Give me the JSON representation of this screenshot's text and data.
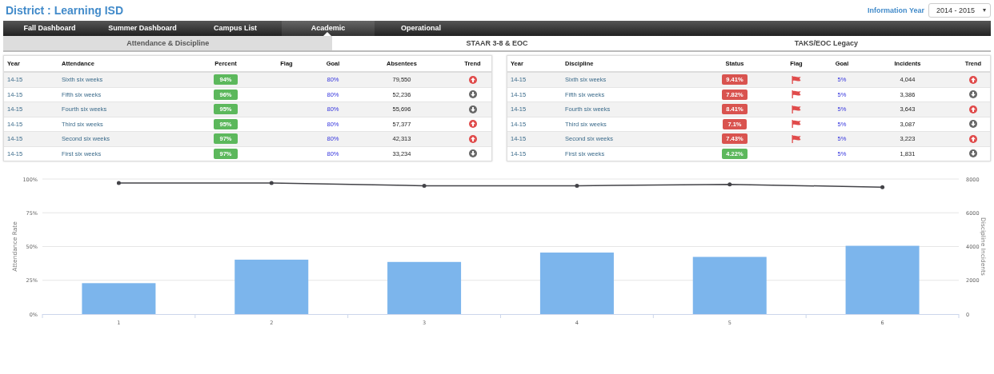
{
  "title": "District : Learning ISD",
  "info_year": {
    "label": "Information Year",
    "value": "2014 - 2015"
  },
  "nav_tabs": [
    {
      "label": "Fall Dashboard",
      "selected": false
    },
    {
      "label": "Summer Dashboard",
      "selected": false
    },
    {
      "label": "Campus List",
      "selected": false
    },
    {
      "label": "Academic",
      "selected": true
    },
    {
      "label": "Operational",
      "selected": false
    }
  ],
  "sub_tabs": [
    {
      "label": "Attendance & Discipline",
      "selected": true
    },
    {
      "label": "STAAR 3-8 & EOC",
      "selected": false
    },
    {
      "label": "TAKS/EOC Legacy",
      "selected": false
    }
  ],
  "attendance_table": {
    "columns": [
      "Year",
      "Attendance",
      "Percent",
      "Flag",
      "Goal",
      "Absentees",
      "Trend"
    ],
    "rows": [
      {
        "year": "14-15",
        "period": "Sixth six weeks",
        "percent": "94%",
        "color": "#5cb85c",
        "flag": false,
        "goal": "80%",
        "count": "79,550",
        "trend_up": true
      },
      {
        "year": "14-15",
        "period": "Fifth six weeks",
        "percent": "96%",
        "color": "#5cb85c",
        "flag": false,
        "goal": "80%",
        "count": "52,236",
        "trend_up": false
      },
      {
        "year": "14-15",
        "period": "Fourth six weeks",
        "percent": "95%",
        "color": "#5cb85c",
        "flag": false,
        "goal": "80%",
        "count": "55,696",
        "trend_up": false
      },
      {
        "year": "14-15",
        "period": "Third six weeks",
        "percent": "95%",
        "color": "#5cb85c",
        "flag": false,
        "goal": "80%",
        "count": "57,377",
        "trend_up": true
      },
      {
        "year": "14-15",
        "period": "Second six weeks",
        "percent": "97%",
        "color": "#5cb85c",
        "flag": false,
        "goal": "80%",
        "count": "42,313",
        "trend_up": true
      },
      {
        "year": "14-15",
        "period": "First six weeks",
        "percent": "97%",
        "color": "#5cb85c",
        "flag": false,
        "goal": "80%",
        "count": "33,234",
        "trend_up": false
      }
    ]
  },
  "discipline_table": {
    "columns": [
      "Year",
      "Discipline",
      "Status",
      "Flag",
      "Goal",
      "Incidents",
      "Trend"
    ],
    "rows": [
      {
        "year": "14-15",
        "period": "Sixth six weeks",
        "percent": "9.41%",
        "color": "#d9534f",
        "flag": true,
        "goal": "5%",
        "count": "4,044",
        "trend_up": true
      },
      {
        "year": "14-15",
        "period": "Fifth six weeks",
        "percent": "7.82%",
        "color": "#d9534f",
        "flag": true,
        "goal": "5%",
        "count": "3,386",
        "trend_up": false
      },
      {
        "year": "14-15",
        "period": "Fourth six weeks",
        "percent": "8.41%",
        "color": "#d9534f",
        "flag": true,
        "goal": "5%",
        "count": "3,643",
        "trend_up": true
      },
      {
        "year": "14-15",
        "period": "Third six weeks",
        "percent": "7.1%",
        "color": "#d9534f",
        "flag": true,
        "goal": "5%",
        "count": "3,087",
        "trend_up": false
      },
      {
        "year": "14-15",
        "period": "Second six weeks",
        "percent": "7.43%",
        "color": "#d9534f",
        "flag": true,
        "goal": "5%",
        "count": "3,223",
        "trend_up": true
      },
      {
        "year": "14-15",
        "period": "First six weeks",
        "percent": "4.22%",
        "color": "#5cb85c",
        "flag": false,
        "goal": "5%",
        "count": "1,831",
        "trend_up": false
      }
    ]
  },
  "chart": {
    "chart_data": {
      "type": "bar",
      "grid": true,
      "ylabel": "Attendance Rate",
      "y2label": "Discipline Incidents",
      "categories": [
        "1",
        "2",
        "3",
        "4",
        "5",
        "6"
      ],
      "yticks": [
        {
          "value": 0,
          "label": "0%"
        },
        {
          "value": 25,
          "label": "25%"
        },
        {
          "value": 50,
          "label": "50%"
        },
        {
          "value": 75,
          "label": "75%"
        },
        {
          "value": 100,
          "label": "100%"
        }
      ],
      "y2ticks": [
        0,
        2000,
        4000,
        6000,
        8000
      ],
      "ylim": [
        0,
        100
      ],
      "y2lim": [
        0,
        8000
      ],
      "series": [
        {
          "axis": "y2",
          "color": "#7cb5ec",
          "values": [
            1831,
            3223,
            3087,
            3643,
            3386,
            4044
          ]
        },
        {
          "type": "line",
          "color": "#434348",
          "values": [
            97,
            97,
            95,
            95,
            96,
            94
          ]
        }
      ]
    }
  }
}
